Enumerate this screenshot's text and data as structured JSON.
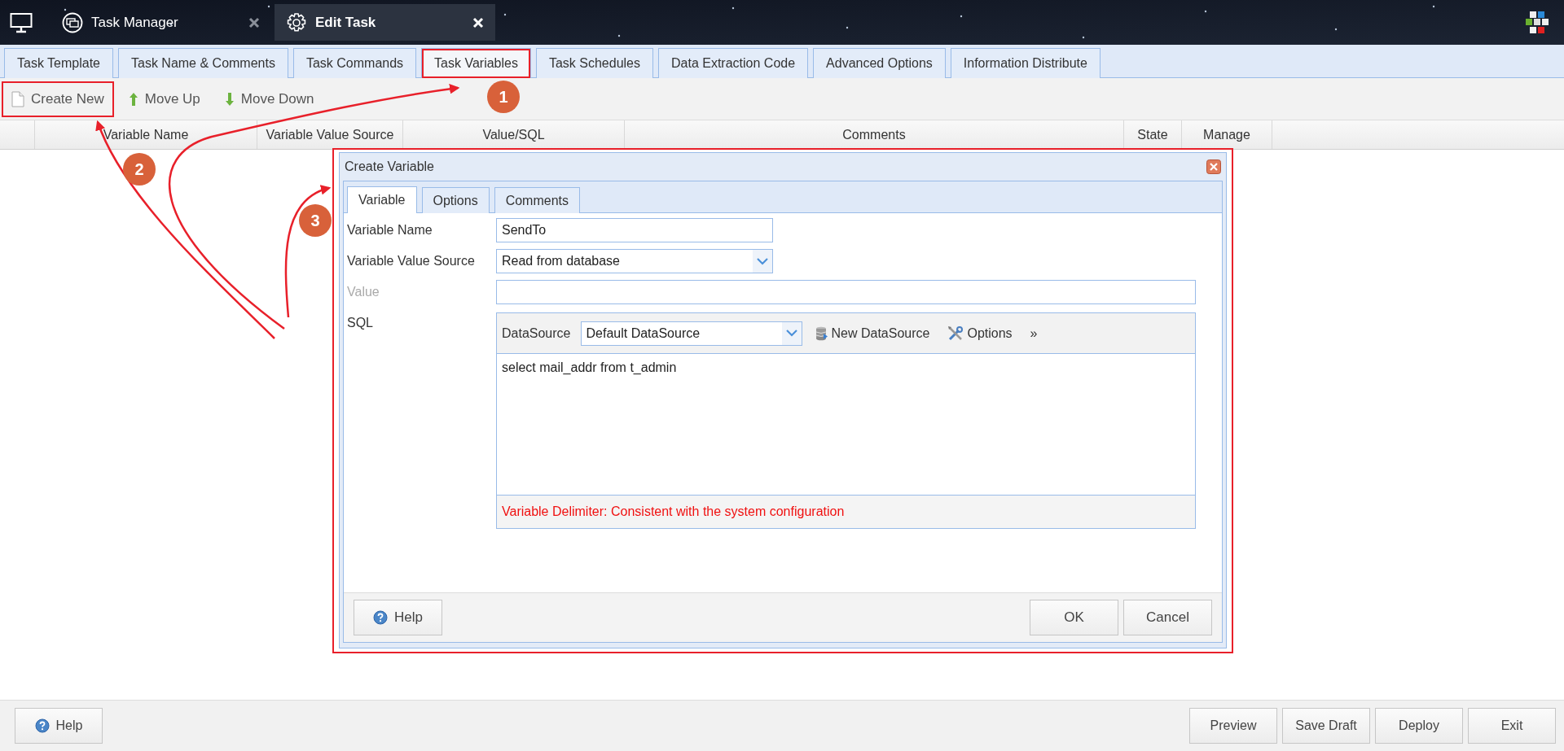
{
  "top_bar": {
    "tabs": [
      {
        "label": "Task Manager",
        "kind": "manager",
        "selected": false
      },
      {
        "label": "Edit Task",
        "kind": "edit",
        "selected": true
      }
    ]
  },
  "tabs": [
    {
      "label": "Task Template",
      "selected": false,
      "highlighted": false
    },
    {
      "label": "Task Name & Comments",
      "selected": false,
      "highlighted": false
    },
    {
      "label": "Task Commands",
      "selected": false,
      "highlighted": false
    },
    {
      "label": "Task Variables",
      "selected": true,
      "highlighted": true
    },
    {
      "label": "Task Schedules",
      "selected": false,
      "highlighted": false
    },
    {
      "label": "Data Extraction Code",
      "selected": false,
      "highlighted": false
    },
    {
      "label": "Advanced Options",
      "selected": false,
      "highlighted": false
    },
    {
      "label": "Information Distribute",
      "selected": false,
      "highlighted": false
    }
  ],
  "toolbar": [
    {
      "label": "Create New",
      "kind": "new",
      "highlighted": true
    },
    {
      "label": "Move Up",
      "kind": "up",
      "highlighted": false
    },
    {
      "label": "Move Down",
      "kind": "down",
      "highlighted": false
    }
  ],
  "table": {
    "columns": [
      "Variable Name",
      "Variable Value Source",
      "Value/SQL",
      "Comments",
      "State",
      "Manage"
    ]
  },
  "dialog": {
    "title": "Create Variable",
    "highlighted": true,
    "tabs": [
      {
        "label": "Variable",
        "selected": true
      },
      {
        "label": "Options",
        "selected": false
      },
      {
        "label": "Comments",
        "selected": false
      }
    ],
    "fields": [
      {
        "label": "Variable Name",
        "kind": "text",
        "value": "SendTo",
        "disabled": false
      },
      {
        "label": "Variable Value Source",
        "kind": "select",
        "value": "Read from database",
        "disabled": false
      },
      {
        "label": "Value",
        "kind": "wide",
        "disabled": true
      },
      {
        "label": "SQL",
        "kind": "sql",
        "disabled": false
      }
    ],
    "sql": {
      "datasource_label": "DataSource",
      "datasource": "Default DataSource",
      "actions": [
        {
          "label": "New DataSource",
          "kind": "database"
        },
        {
          "label": "Options",
          "kind": "tools"
        },
        {
          "label": "»",
          "kind": "more"
        }
      ],
      "query": "select mail_addr from t_admin",
      "note": "Variable Delimiter: Consistent with the system configuration"
    },
    "buttons": [
      {
        "label": "Help",
        "kind": "help"
      },
      {
        "label": "OK",
        "kind": "plain"
      },
      {
        "label": "Cancel",
        "kind": "plain"
      }
    ]
  },
  "footer": {
    "buttons": [
      {
        "label": "Help",
        "kind": "help"
      },
      {
        "label": "Preview",
        "kind": "plain"
      },
      {
        "label": "Save Draft",
        "kind": "plain"
      },
      {
        "label": "Deploy",
        "kind": "plain"
      },
      {
        "label": "Exit",
        "kind": "plain"
      }
    ]
  },
  "annotations": [
    "1",
    "2",
    "3"
  ]
}
